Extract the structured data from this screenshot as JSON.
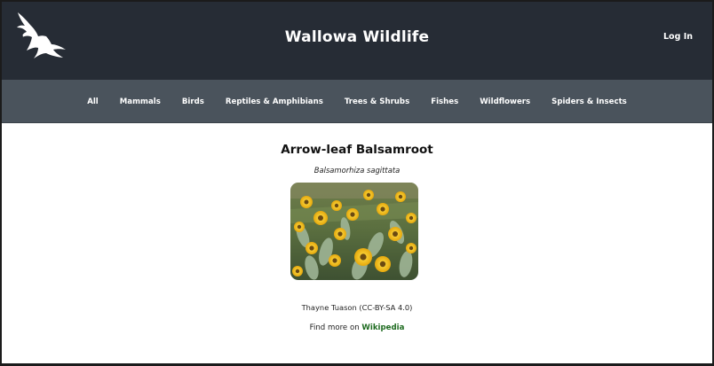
{
  "header": {
    "logo_icon": "bird-silhouette-icon",
    "title": "Wallowa Wildlife",
    "login_label": "Log In",
    "background": "#262c35"
  },
  "nav": {
    "background": "#4a535c",
    "items": [
      {
        "label": "All"
      },
      {
        "label": "Mammals"
      },
      {
        "label": "Birds"
      },
      {
        "label": "Reptiles & Amphibians"
      },
      {
        "label": "Trees & Shrubs"
      },
      {
        "label": "Fishes"
      },
      {
        "label": "Wildflowers"
      },
      {
        "label": "Spiders & Insects"
      }
    ]
  },
  "species": {
    "common_name": "Arrow-leaf Balsamroot",
    "scientific_name": "Balsamorhiza sagittata",
    "photo_subject": "arrow-leaf balsamroot wildflowers",
    "credit": "Thayne Tuason (CC-BY-SA 4.0)",
    "find_more_prefix": "Find more on ",
    "find_more_link": "Wikipedia",
    "link_color": "#1e6b20"
  }
}
